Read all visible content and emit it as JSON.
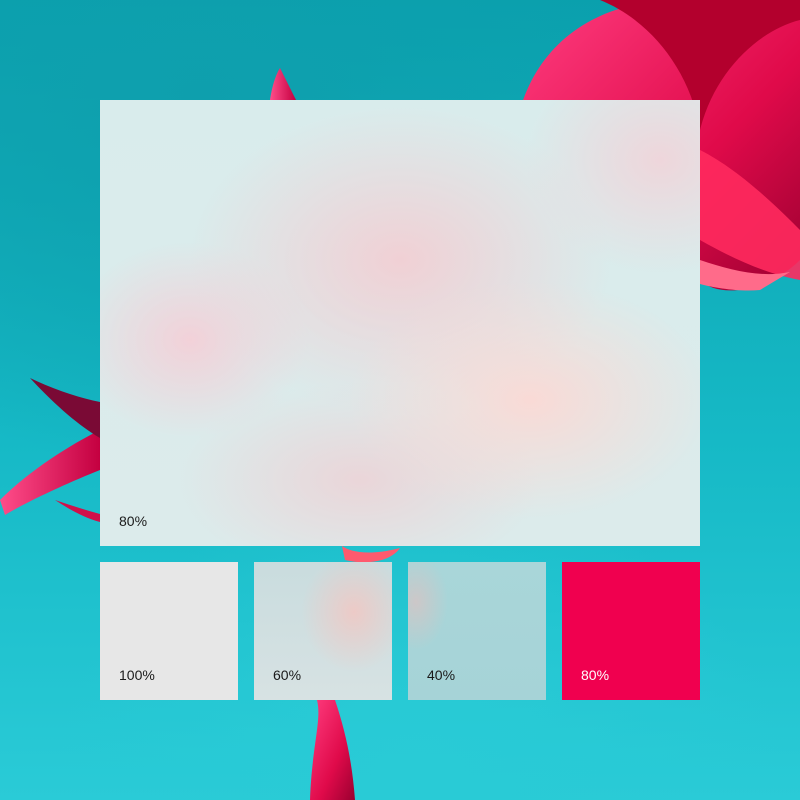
{
  "background": {
    "image": "teal-background-with-pink-flower-petals",
    "colors": {
      "teal": "#12b5c3",
      "petal_pink": "#e8175d",
      "petal_deep": "#b80036"
    }
  },
  "swatches": {
    "main": {
      "label": "80%",
      "material": "acrylic-blur",
      "opacity_percent": 80
    },
    "solid": {
      "label": "100%",
      "color": "#e7e7e7",
      "opacity_percent": 100
    },
    "medium": {
      "label": "60%",
      "material": "acrylic-blur",
      "opacity_percent": 60
    },
    "light": {
      "label": "40%",
      "material": "acrylic-blur",
      "opacity_percent": 40
    },
    "accent": {
      "label": "80%",
      "color": "#f0004f",
      "opacity_percent": 80
    }
  }
}
